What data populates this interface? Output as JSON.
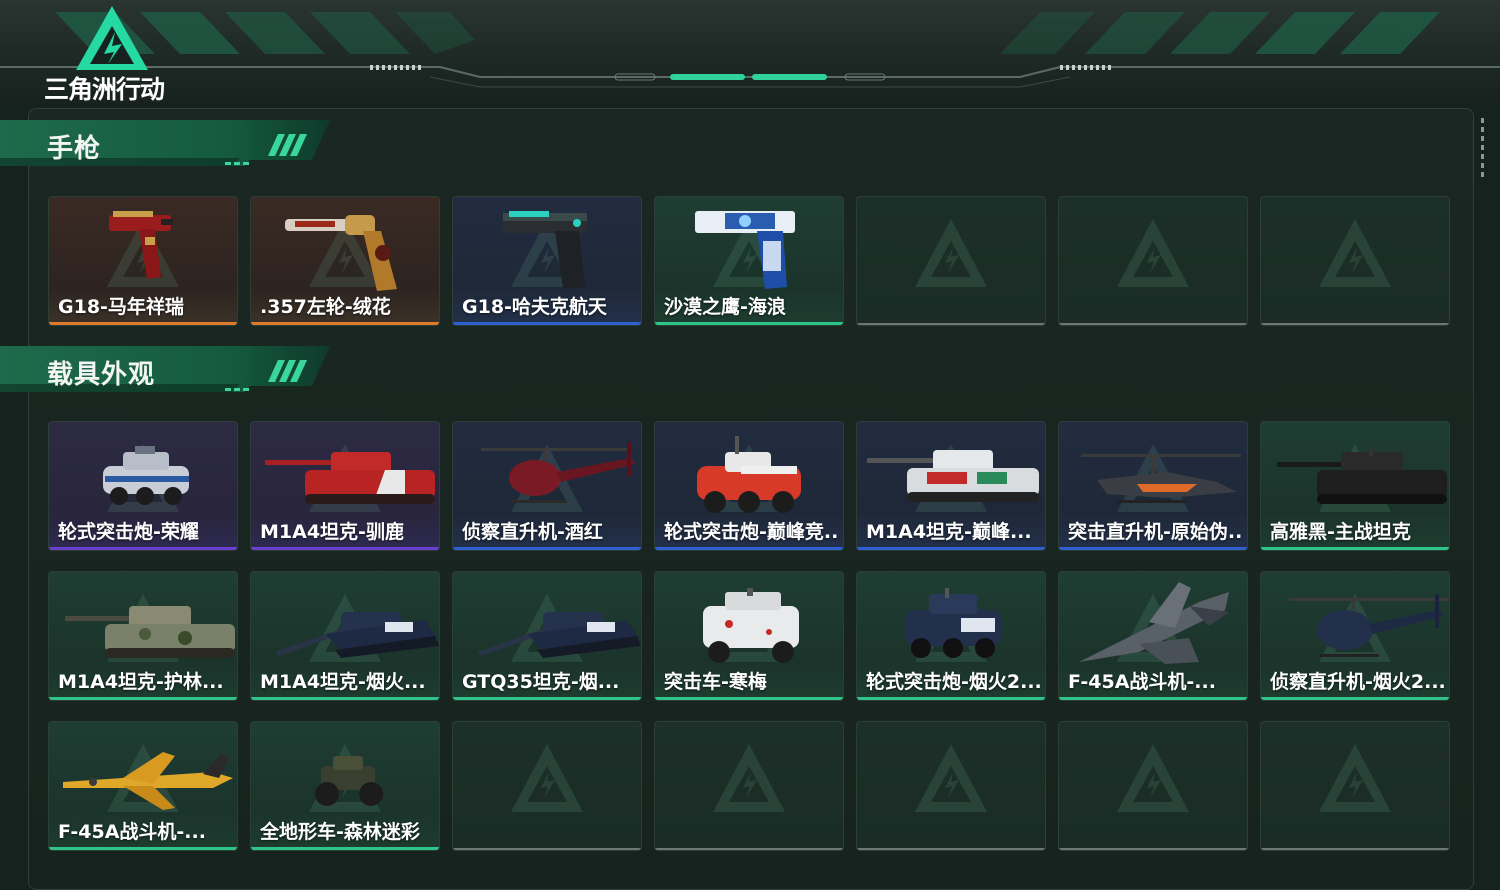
{
  "app": {
    "logo_text": "三角洲行动"
  },
  "sections": [
    {
      "title": "手枪",
      "items": [
        {
          "label": "G18-马年祥瑞",
          "rarity": "orange",
          "icon": "pistol-red-icon"
        },
        {
          "label": ".357左轮-绒花",
          "rarity": "orange",
          "icon": "revolver-gold-icon"
        },
        {
          "label": "G18-哈夫克航天",
          "rarity": "blue",
          "icon": "pistol-black-icon"
        },
        {
          "label": "沙漠之鹰-海浪",
          "rarity": "green",
          "icon": "desert-eagle-blue-icon"
        },
        {
          "label": "",
          "rarity": "empty"
        },
        {
          "label": "",
          "rarity": "empty"
        },
        {
          "label": "",
          "rarity": "empty"
        }
      ]
    },
    {
      "title": "载具外观",
      "items": [
        {
          "label": "轮式突击炮-荣耀",
          "rarity": "purple",
          "icon": "armored-car-icon"
        },
        {
          "label": "M1A4坦克-驯鹿",
          "rarity": "purple",
          "icon": "tank-red-icon"
        },
        {
          "label": "侦察直升机-酒红",
          "rarity": "blue",
          "icon": "helicopter-red-icon"
        },
        {
          "label": "轮式突击炮-巅峰竞...",
          "rarity": "blue",
          "icon": "armored-car-red-icon"
        },
        {
          "label": "M1A4坦克-巅峰...",
          "rarity": "blue",
          "icon": "tank-white-icon"
        },
        {
          "label": "突击直升机-原始伪...",
          "rarity": "blue",
          "icon": "attack-helicopter-icon"
        },
        {
          "label": "高雅黑-主战坦克",
          "rarity": "green",
          "icon": "tank-black-icon"
        },
        {
          "label": "M1A4坦克-护林...",
          "rarity": "green",
          "icon": "tank-camo-icon"
        },
        {
          "label": "M1A4坦克-烟火...",
          "rarity": "green",
          "icon": "tank-navy-icon"
        },
        {
          "label": "GTQ35坦克-烟...",
          "rarity": "green",
          "icon": "tank-navy-icon"
        },
        {
          "label": "突击车-寒梅",
          "rarity": "green",
          "icon": "assault-vehicle-white-icon"
        },
        {
          "label": "轮式突击炮-烟火2...",
          "rarity": "green",
          "icon": "armored-car-navy-icon"
        },
        {
          "label": "F-45A战斗机-...",
          "rarity": "green",
          "icon": "fighter-jet-grey-icon"
        },
        {
          "label": "侦察直升机-烟火2...",
          "rarity": "green",
          "icon": "helicopter-navy-icon"
        },
        {
          "label": "F-45A战斗机-...",
          "rarity": "green",
          "icon": "fighter-jet-yellow-icon"
        },
        {
          "label": "全地形车-森林迷彩",
          "rarity": "green",
          "icon": "atv-icon"
        },
        {
          "label": "",
          "rarity": "empty"
        },
        {
          "label": "",
          "rarity": "empty"
        },
        {
          "label": "",
          "rarity": "empty"
        },
        {
          "label": "",
          "rarity": "empty"
        },
        {
          "label": "",
          "rarity": "empty"
        }
      ]
    }
  ],
  "colors": {
    "accent": "#2fd39a",
    "orange": "#e07a2c",
    "blue": "#2f5fd0",
    "purple": "#6b3fd0",
    "green": "#2fc58a",
    "empty": "#6e7772"
  }
}
